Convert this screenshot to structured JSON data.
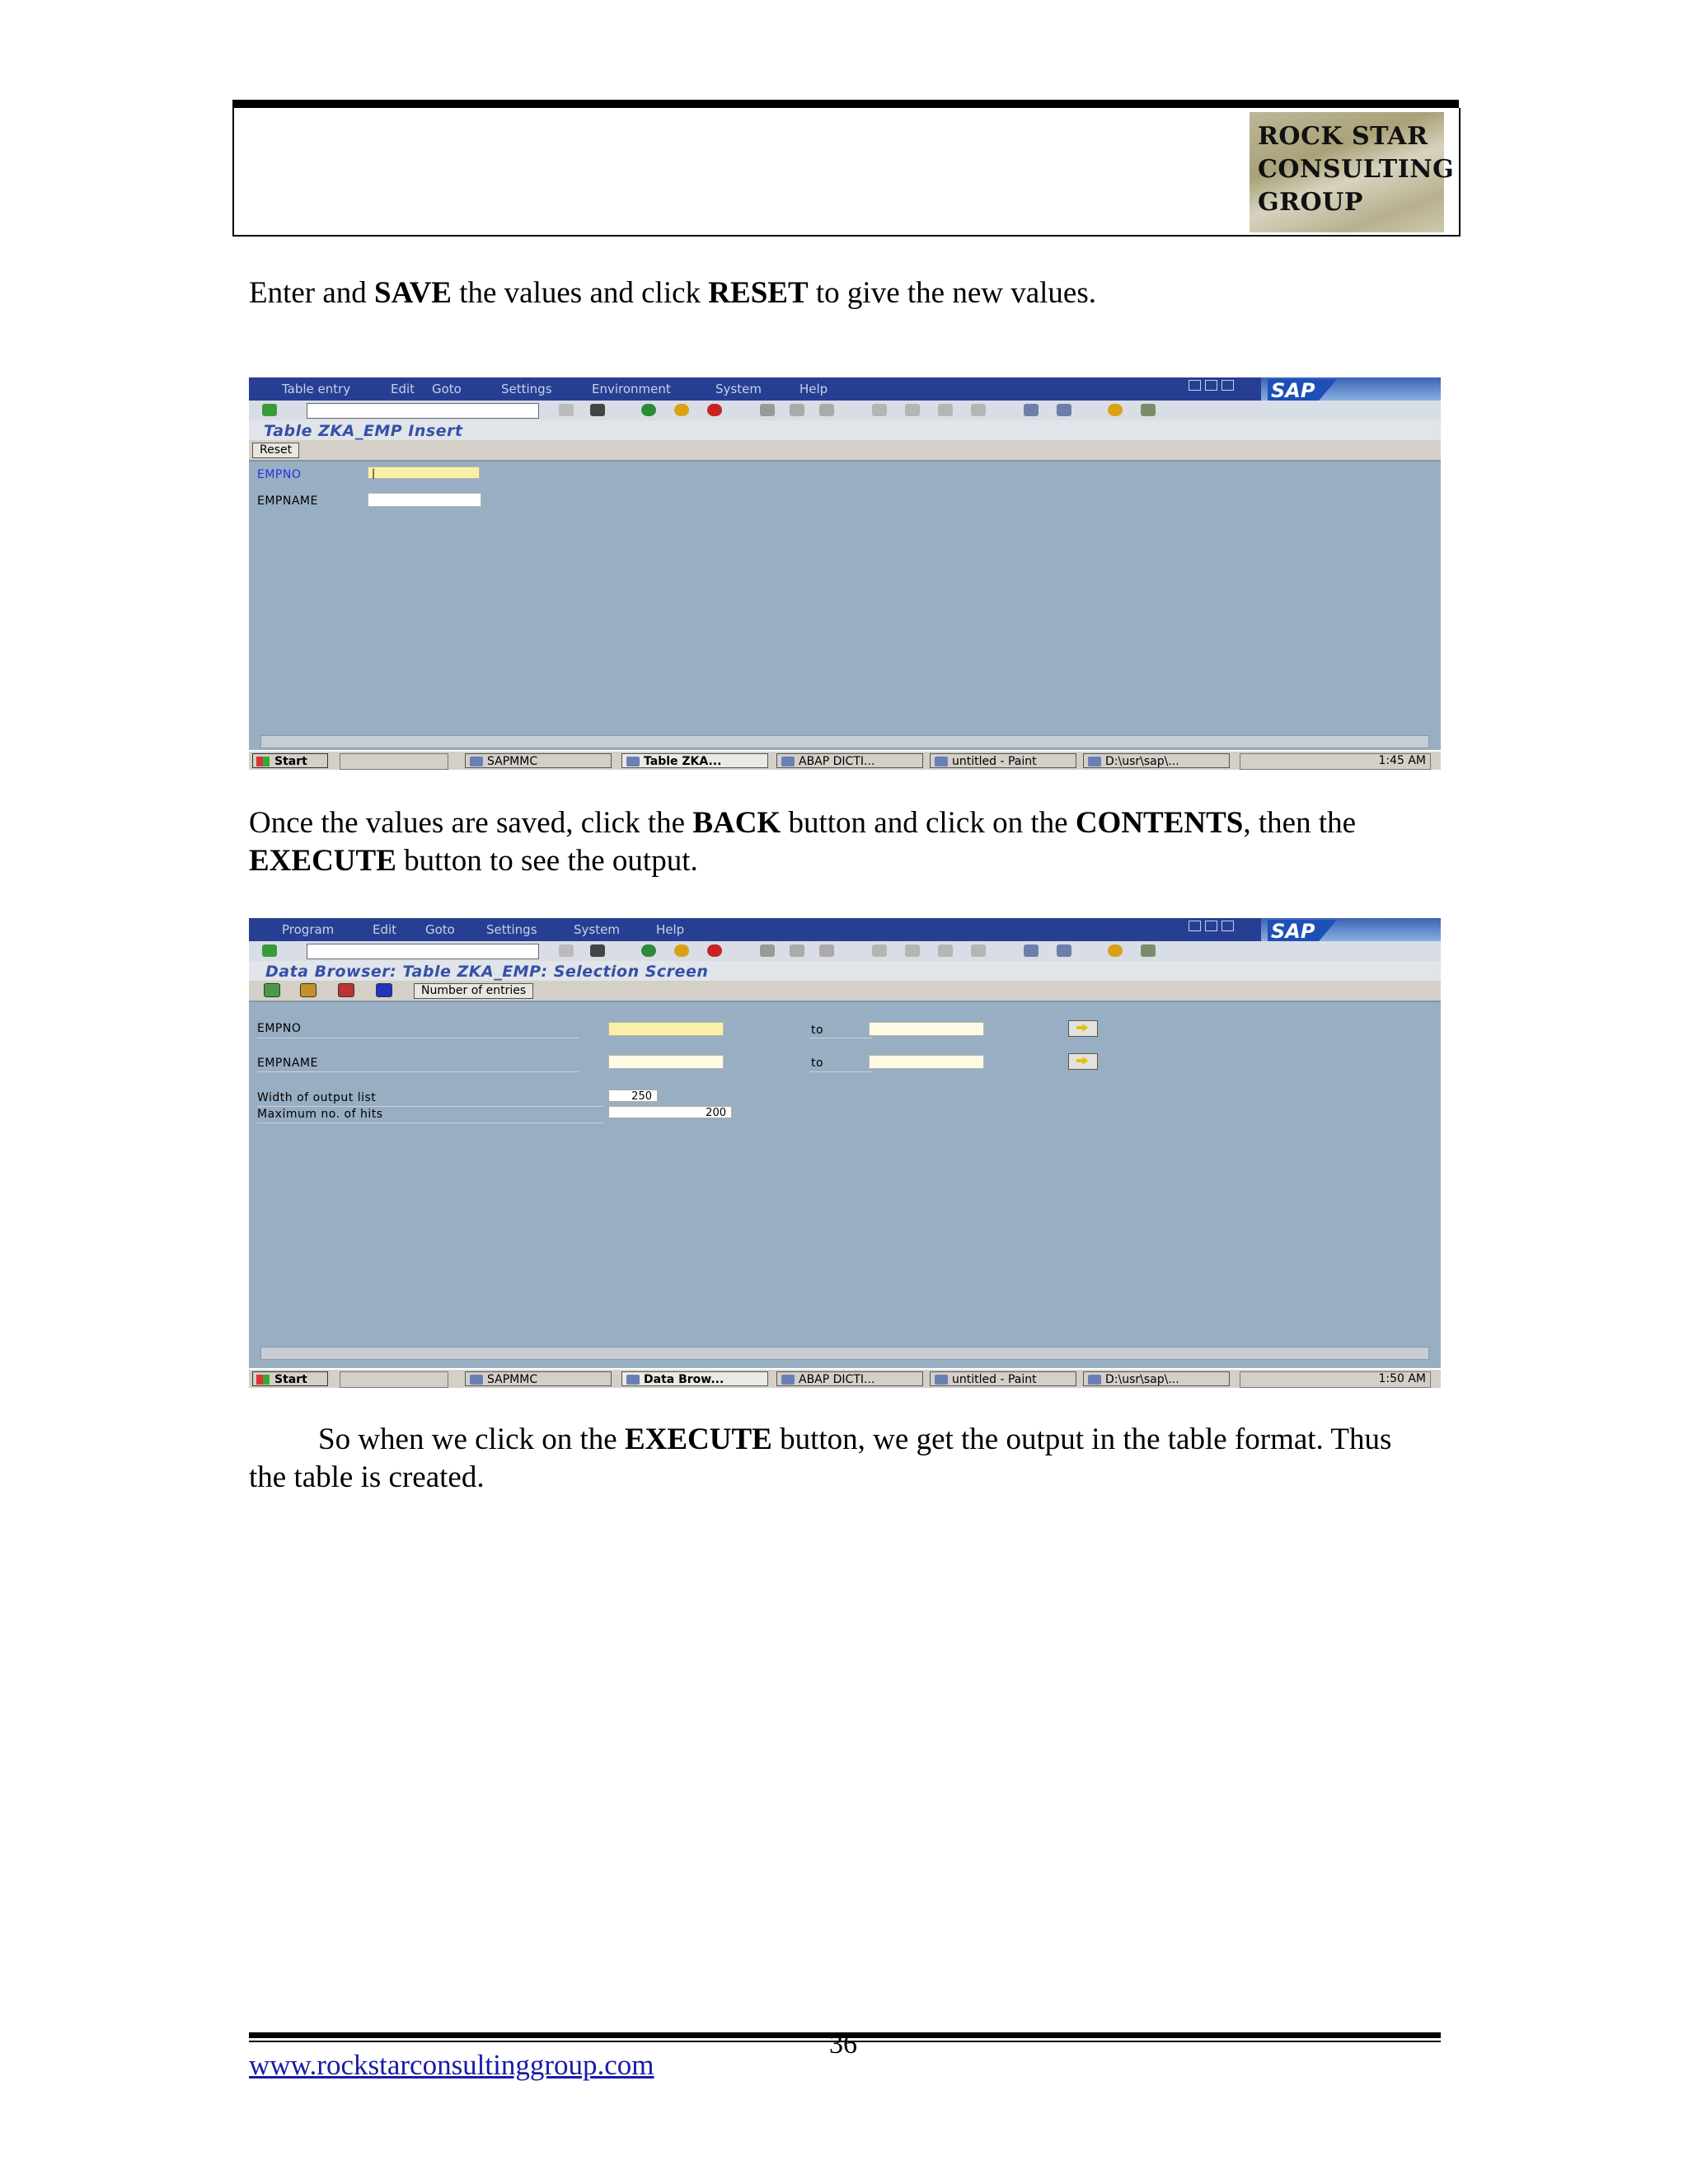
{
  "header": {
    "logo_lines": [
      "ROCK STAR",
      "CONSULTING",
      "GROUP"
    ]
  },
  "paragraphs": {
    "p1": {
      "a": "Enter and ",
      "b1": "SAVE",
      "c": " the values and click ",
      "b2": "RESET",
      "d": " to give the new values."
    },
    "p2": {
      "a": "Once the values are saved, click the ",
      "b1": "BACK",
      "c": " button and click on the ",
      "b2": "CONTENTS",
      "d": ", then the ",
      "b3": "EXECUTE",
      "e": " button to see the output."
    },
    "p3": {
      "a": "So when we click on the ",
      "b1": "EXECUTE",
      "c": " button, we get the output in the table format. Thus the table is created."
    }
  },
  "screen1": {
    "menu": [
      "Table entry",
      "Edit",
      "Goto",
      "Settings",
      "Environment",
      "System",
      "Help"
    ],
    "sap_logo": "SAP",
    "title": "Table ZKA_EMP Insert",
    "reset_button": "Reset",
    "fields": [
      {
        "label": "EMPNO",
        "value": "|"
      },
      {
        "label": "EMPNAME",
        "value": ""
      }
    ],
    "taskbar": {
      "start": "Start",
      "tasks": [
        "SAPMMC",
        "Table ZKA...",
        "ABAP DICTI...",
        "untitled - Paint",
        "D:\\usr\\sap\\..."
      ],
      "clock": "1:45 AM"
    }
  },
  "screen2": {
    "menu": [
      "Program",
      "Edit",
      "Goto",
      "Settings",
      "System",
      "Help"
    ],
    "sap_logo": "SAP",
    "title": "Data Browser: Table ZKA_EMP: Selection Screen",
    "number_of_entries_button": "Number of entries",
    "fields": [
      {
        "label": "EMPNO",
        "to": "to"
      },
      {
        "label": "EMPNAME",
        "to": "to"
      }
    ],
    "width_label": "Width of output list",
    "width_value": "250",
    "max_hits_label": "Maximum no. of hits",
    "max_hits_value": "200",
    "taskbar": {
      "start": "Start",
      "tasks": [
        "SAPMMC",
        "Data Brow...",
        "ABAP DICTI...",
        "untitled - Paint",
        "D:\\usr\\sap\\..."
      ],
      "clock": "1:50 AM"
    }
  },
  "footer": {
    "url": "www.rockstarconsultinggroup.com",
    "page_number": "36"
  }
}
